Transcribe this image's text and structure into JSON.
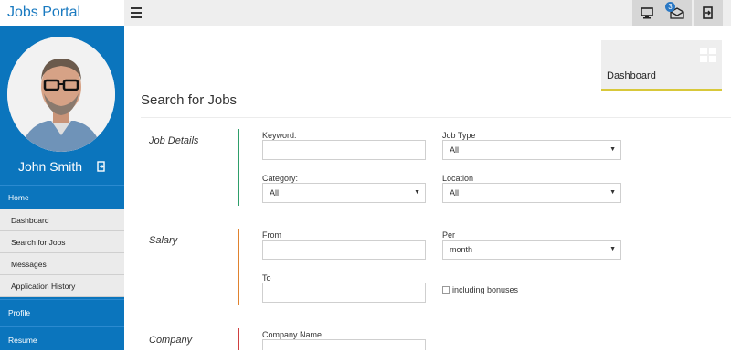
{
  "app": {
    "title": "Jobs Portal"
  },
  "topbar": {
    "notification_count": "3"
  },
  "user": {
    "name": "John Smith"
  },
  "sidebar": {
    "home": "Home",
    "sub_items": [
      "Dashboard",
      "Search for Jobs",
      "Messages",
      "Application History"
    ],
    "profile": "Profile",
    "resume": "Resume"
  },
  "dashboard_tile": {
    "label": "Dashboard"
  },
  "page": {
    "title": "Search for Jobs"
  },
  "sections": {
    "job_details": "Job Details",
    "salary": "Salary",
    "company": "Company"
  },
  "form": {
    "keyword": {
      "label": "Keyword:",
      "value": ""
    },
    "job_type": {
      "label": "Job Type",
      "value": "All"
    },
    "category": {
      "label": "Category:",
      "value": "All"
    },
    "location": {
      "label": "Location",
      "value": "All"
    },
    "from": {
      "label": "From",
      "value": ""
    },
    "per": {
      "label": "Per",
      "value": "month"
    },
    "to": {
      "label": "To",
      "value": ""
    },
    "including_bonuses": "including bonuses",
    "company_name": {
      "label": "Company Name",
      "value": ""
    }
  },
  "colors": {
    "brand": "#0b75bd",
    "job_details_bar": "#2e9e6a",
    "salary_bar": "#e0822e",
    "company_bar": "#d04040",
    "dashboard_accent": "#d8c83a"
  },
  "icons": [
    "menu-icon",
    "monitor-icon",
    "mail-icon",
    "logout-icon",
    "windows-icon",
    "dropdown-caret-icon"
  ]
}
